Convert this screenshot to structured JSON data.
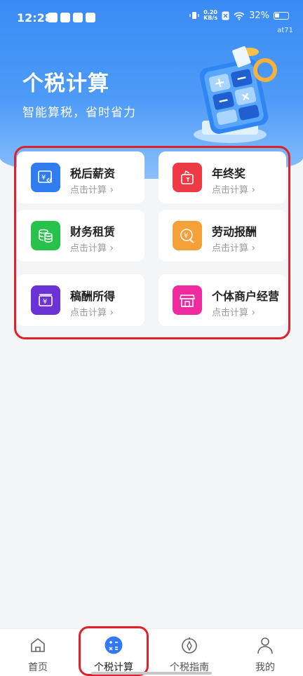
{
  "status_bar": {
    "time": "12:28",
    "net_speed_value": "0.20",
    "net_speed_unit": "KB/s",
    "battery": "32%",
    "carrier_tag": "at71"
  },
  "header": {
    "title": "个税计算",
    "subtitle": "智能算税，省时省力"
  },
  "cards": [
    {
      "label": "税后薪资",
      "sub": "点击计算",
      "color": "#2f7df0",
      "icon": "salary-icon"
    },
    {
      "label": "年终奖",
      "sub": "点击计算",
      "color": "#ee3a45",
      "icon": "bonus-icon"
    },
    {
      "label": "财务租赁",
      "sub": "点击计算",
      "color": "#27c24c",
      "icon": "coins-icon"
    },
    {
      "label": "劳动报酬",
      "sub": "点击计算",
      "color": "#f5a13a",
      "icon": "labor-icon"
    },
    {
      "label": "稿酬所得",
      "sub": "点击计算",
      "color": "#6b33d6",
      "icon": "royalty-icon"
    },
    {
      "label": "个体商户经营",
      "sub": "点击计算",
      "color": "#ef2a9e",
      "icon": "shop-icon"
    }
  ],
  "nav": {
    "items": [
      {
        "label": "首页",
        "icon": "home-icon"
      },
      {
        "label": "个税计算",
        "icon": "calculator-icon"
      },
      {
        "label": "个税指南",
        "icon": "compass-icon"
      },
      {
        "label": "我的",
        "icon": "user-icon"
      }
    ],
    "active_index": 1,
    "active_color": "#3478f6"
  }
}
